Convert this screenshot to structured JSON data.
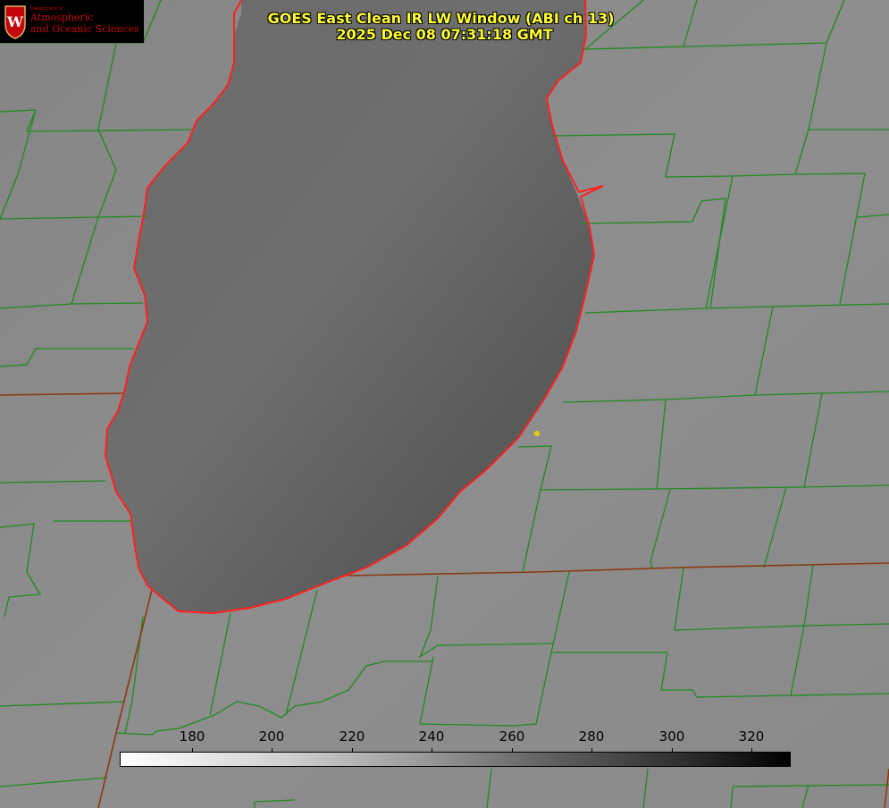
{
  "logo": {
    "dept": "Department of",
    "line1": "Atmospheric",
    "line2": "and Oceanic Sciences"
  },
  "title": {
    "line1": "GOES East Clean IR LW Window (ABI ch 13)",
    "line2": "2025 Dec 08 07:31:18 GMT"
  },
  "colorbar": {
    "ticks": [
      "180",
      "200",
      "220",
      "240",
      "260",
      "280",
      "300",
      "320"
    ],
    "gradient": "white-to-black"
  },
  "colors": {
    "background": "#8a8a8a",
    "lake": "#5e5e5e",
    "county_lines": "#1f8a1f",
    "state_lines": "#8a3a10",
    "shoreline": "#ff2020",
    "title_text": "#ffff33",
    "station_marker": "#e6d200"
  }
}
